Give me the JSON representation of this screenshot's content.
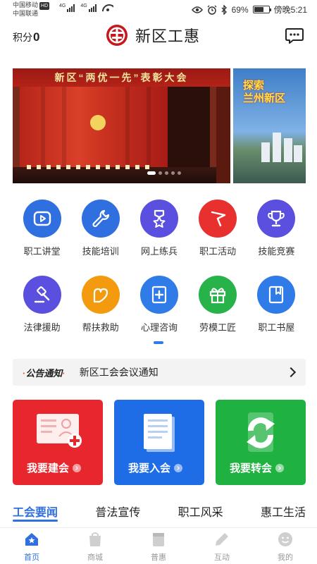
{
  "status_bar": {
    "carrier1": "中国移动",
    "hd": "HD",
    "carrier2": "中国联通",
    "net1": "4G",
    "net2": "4G",
    "battery_text": "69%",
    "battery_level": 0.69,
    "time": "傍晚5:21"
  },
  "header": {
    "points_label": "积分",
    "points_value": "0",
    "app_title": "新区工惠"
  },
  "banner": {
    "slide1_title": "新区“两优一先”表彰大会",
    "slide2_title": "探索\n兰州新区",
    "slide_count": 5,
    "active_index": 0
  },
  "services": [
    {
      "label": "职工讲堂",
      "icon": "play-icon",
      "color": "#2f6fe0"
    },
    {
      "label": "技能培训",
      "icon": "wrench-icon",
      "color": "#2f6fe0"
    },
    {
      "label": "网上练兵",
      "icon": "medal-icon",
      "color": "#5b4fe0"
    },
    {
      "label": "职工活动",
      "icon": "flag-icon",
      "color": "#e8312f"
    },
    {
      "label": "技能竞赛",
      "icon": "trophy-icon",
      "color": "#5b4fe0"
    },
    {
      "label": "法律援助",
      "icon": "gavel-icon",
      "color": "#5b4fe0"
    },
    {
      "label": "帮扶救助",
      "icon": "hand-heart-icon",
      "color": "#f39a0f"
    },
    {
      "label": "心理咨询",
      "icon": "book-plus-icon",
      "color": "#2f7be8"
    },
    {
      "label": "劳模工匠",
      "icon": "gift-icon",
      "color": "#27b24a"
    },
    {
      "label": "职工书屋",
      "icon": "bookmark-book-icon",
      "color": "#2f7be8"
    }
  ],
  "notice": {
    "tag": "公告通知",
    "text": "新区工会会议通知"
  },
  "cards": [
    {
      "label": "我要建会",
      "color": "#e8262d",
      "icon": "add-member-card-icon"
    },
    {
      "label": "我要入会",
      "color": "#1e6ce6",
      "icon": "document-icon"
    },
    {
      "label": "我要转会",
      "color": "#1fb241",
      "icon": "transfer-icon"
    }
  ],
  "tabs": [
    {
      "label": "工会要闻",
      "active": true
    },
    {
      "label": "普法宣传",
      "active": false
    },
    {
      "label": "职工风采",
      "active": false
    },
    {
      "label": "惠工生活",
      "active": false
    }
  ],
  "bottom_nav": [
    {
      "label": "首页",
      "icon": "home-icon",
      "active": true
    },
    {
      "label": "商城",
      "icon": "shopping-bag-icon",
      "active": false
    },
    {
      "label": "普惠",
      "icon": "bookmark-icon",
      "active": false
    },
    {
      "label": "互动",
      "icon": "pencil-icon",
      "active": false
    },
    {
      "label": "我的",
      "icon": "profile-face-icon",
      "active": false
    }
  ]
}
